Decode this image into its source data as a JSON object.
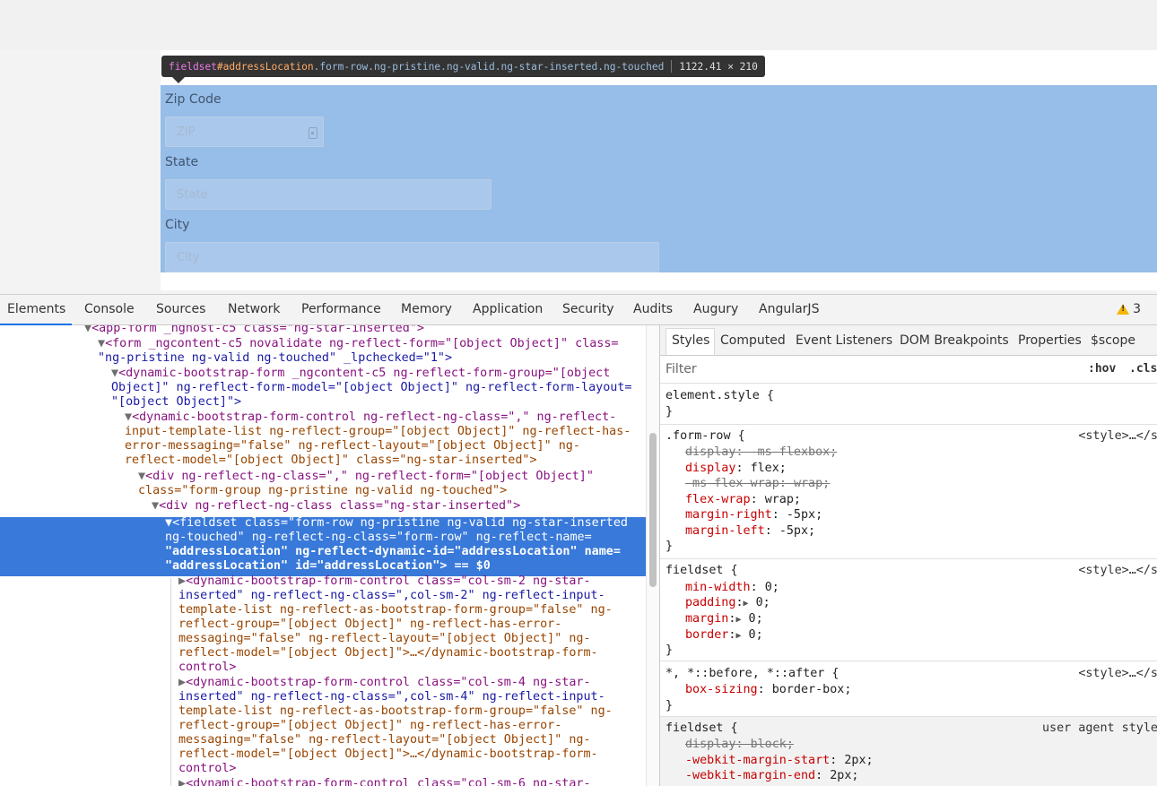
{
  "tooltip": {
    "tag": "fieldset",
    "id": "#addressLocation",
    "classes": ".form-row.ng-pristine.ng-valid.ng-star-inserted.ng-touched",
    "size": "1122.41 × 210"
  },
  "form": {
    "zip_label": "Zip Code",
    "zip_placeholder": "ZIP",
    "state_label": "State",
    "state_placeholder": "State",
    "city_label": "City",
    "city_placeholder": "City"
  },
  "devtools_tabs": [
    "Elements",
    "Console",
    "Sources",
    "Network",
    "Performance",
    "Memory",
    "Application",
    "Security",
    "Audits",
    "Augury",
    "AngularJS"
  ],
  "warnings_count": "3",
  "styles_tabs": [
    "Styles",
    "Computed",
    "Event Listeners",
    "DOM Breakpoints",
    "Properties",
    "$scope"
  ],
  "filter": {
    "placeholder": "Filter",
    "hov": ":hov",
    "cls": ".cls"
  },
  "dom_lines": [
    "<app-form _nghost-c5 class=\"ng-star-inserted\">",
    "<form _ngcontent-c5 novalidate ng-reflect-form=\"[object Object]\" class=",
    "\"ng-pristine ng-valid ng-touched\" _lpchecked=\"1\">",
    "<dynamic-bootstrap-form _ngcontent-c5 ng-reflect-form-group=\"[object",
    "Object]\" ng-reflect-form-model=\"[object Object]\" ng-reflect-form-layout=",
    "\"[object Object]\">",
    "<dynamic-bootstrap-form-control ng-reflect-ng-class=\",\" ng-reflect-",
    "input-template-list ng-reflect-group=\"[object Object]\" ng-reflect-has-",
    "error-messaging=\"false\" ng-reflect-layout=\"[object Object]\" ng-",
    "reflect-model=\"[object Object]\" class=\"ng-star-inserted\">",
    "<div ng-reflect-ng-class=\",\" ng-reflect-form=\"[object Object]\"",
    "class=\"form-group ng-pristine ng-valid ng-touched\">",
    "<div ng-reflect-ng-class class=\"ng-star-inserted\">",
    "<fieldset class=\"form-row ng-pristine ng-valid ng-star-inserted",
    "ng-touched\" ng-reflect-ng-class=\"form-row\" ng-reflect-name=",
    "\"addressLocation\" ng-reflect-dynamic-id=\"addressLocation\" name=",
    "\"addressLocation\" id=\"addressLocation\"> == $0",
    "<dynamic-bootstrap-form-control class=\"col-sm-2 ng-star-",
    "inserted\" ng-reflect-ng-class=\",col-sm-2\" ng-reflect-input-",
    "template-list ng-reflect-as-bootstrap-form-group=\"false\" ng-",
    "reflect-group=\"[object Object]\" ng-reflect-has-error-",
    "messaging=\"false\" ng-reflect-layout=\"[object Object]\" ng-",
    "reflect-model=\"[object Object]\">…</dynamic-bootstrap-form-",
    "control>",
    "<dynamic-bootstrap-form-control class=\"col-sm-4 ng-star-",
    "inserted\" ng-reflect-ng-class=\",col-sm-4\" ng-reflect-input-",
    "template-list ng-reflect-as-bootstrap-form-group=\"false\" ng-",
    "reflect-group=\"[object Object]\" ng-reflect-has-error-",
    "messaging=\"false\" ng-reflect-layout=\"[object Object]\" ng-",
    "reflect-model=\"[object Object]\">…</dynamic-bootstrap-form-",
    "control>",
    "<dynamic-bootstrap-form-control class=\"col-sm-6 ng-star-"
  ],
  "style_rules": {
    "element_style": "element.style {",
    "close": "}",
    "form_row": {
      "selector": ".form-row {",
      "source": "<style>…</s",
      "decls": [
        {
          "prop": "display",
          "val": "-ms-flexbox;",
          "struck": true
        },
        {
          "prop": "display",
          "val": "flex;",
          "struck": false
        },
        {
          "prop": "-ms-flex-wrap",
          "val": "wrap;",
          "struck": true
        },
        {
          "prop": "flex-wrap",
          "val": "wrap;",
          "struck": false
        },
        {
          "prop": "margin-right",
          "val": "-5px;",
          "struck": false
        },
        {
          "prop": "margin-left",
          "val": "-5px;",
          "struck": false
        }
      ]
    },
    "fieldset": {
      "selector": "fieldset {",
      "source": "<style>…</s",
      "decls": [
        {
          "prop": "min-width",
          "val": "0;"
        },
        {
          "prop": "padding",
          "val": "0;"
        },
        {
          "prop": "margin",
          "val": "0;"
        },
        {
          "prop": "border",
          "val": "0;"
        }
      ]
    },
    "universal": {
      "selector": "*, *::before, *::after {",
      "source": "<style>…</s",
      "decls": [
        {
          "prop": "box-sizing",
          "val": "border-box;"
        }
      ]
    },
    "ua_fieldset": {
      "selector": "fieldset {",
      "source": "user agent style",
      "decls": [
        {
          "prop": "display",
          "val": "block;",
          "struck": true
        },
        {
          "prop": "-webkit-margin-start",
          "val": "2px;"
        },
        {
          "prop": "-webkit-margin-end",
          "val": "2px;"
        }
      ]
    }
  },
  "colors": {
    "highlight": "#97bde9",
    "selection": "#3879d9",
    "tag": "#881280",
    "attr_name": "#994500",
    "attr_value": "#1a1aa6",
    "css_prop": "#c80000"
  }
}
